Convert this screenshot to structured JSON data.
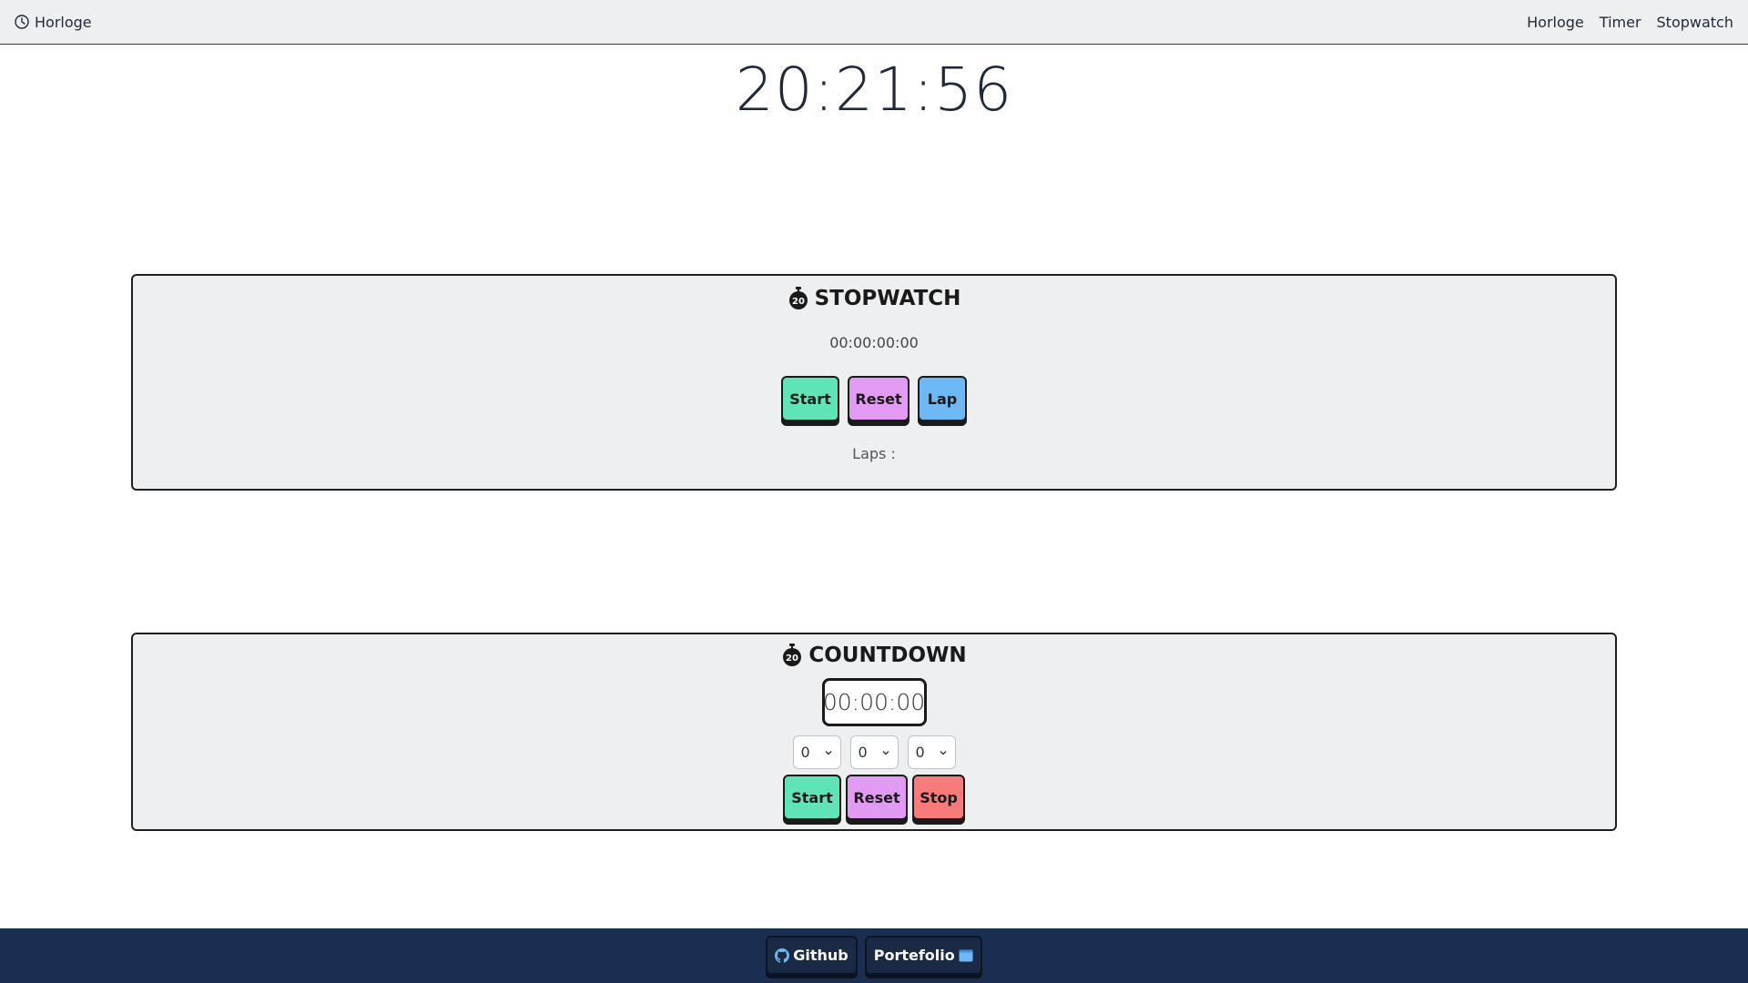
{
  "navbar": {
    "brand": "Horloge",
    "brand_icon": "clock-icon",
    "links": [
      "Horloge",
      "Timer",
      "Stopwatch"
    ]
  },
  "clock": {
    "time": "20:21:56"
  },
  "stopwatch": {
    "title": "STOPWATCH",
    "icon": "stopwatch-icon",
    "time": "00:00:00:00",
    "buttons": {
      "start": "Start",
      "reset": "Reset",
      "lap": "Lap"
    },
    "laps_label": "Laps :"
  },
  "countdown": {
    "title": "COUNTDOWN",
    "icon": "stopwatch-icon",
    "display": "00:00:00",
    "selects": {
      "hours": "0",
      "minutes": "0",
      "seconds": "0"
    },
    "buttons": {
      "start": "Start",
      "reset": "Reset",
      "stop": "Stop"
    }
  },
  "footer": {
    "github": "Github",
    "github_icon": "github-icon",
    "portfolio": "Portefolio",
    "portfolio_icon": "browser-window-icon"
  },
  "colors": {
    "start": "#5fe3b7",
    "reset": "#e19bf2",
    "lap": "#6eb8f5",
    "stop": "#f77b7b",
    "footer_bg": "#1a2e52",
    "panel_bg": "#eeeff1"
  }
}
